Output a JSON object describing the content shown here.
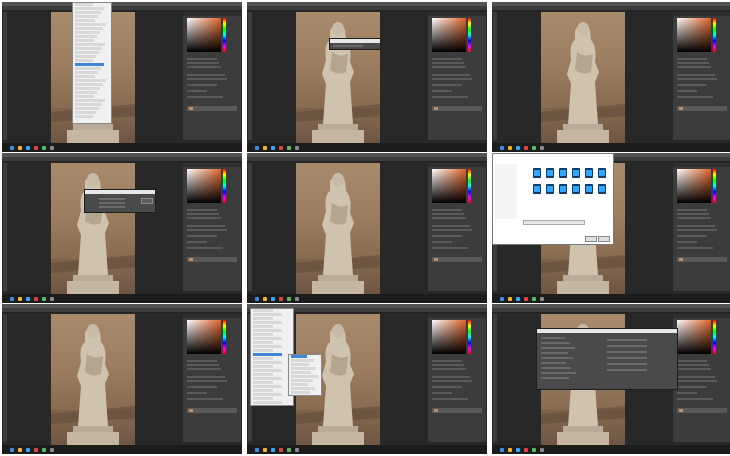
{
  "frames": [
    {
      "id": "f1",
      "menu": "edit-menu-open"
    },
    {
      "id": "f2",
      "dialog": "small-prompt"
    },
    {
      "id": "f3"
    },
    {
      "id": "f4",
      "dialog": "adjustment-dialog"
    },
    {
      "id": "f5"
    },
    {
      "id": "f6",
      "dialog": "file-explorer"
    },
    {
      "id": "f7"
    },
    {
      "id": "f8",
      "menu": "file-menu-open"
    },
    {
      "id": "f9",
      "dialog": "preferences-dialog"
    }
  ],
  "colors": {
    "canvas_bg": "#282828",
    "panel": "#3c3c3c",
    "menubar": "#535353",
    "accent": "#e0632a",
    "highlight": "#3f86d4"
  },
  "icons": {
    "layer_thumb": "layer-thumbnail-icon",
    "ps_file": "photoshop-file-icon"
  }
}
